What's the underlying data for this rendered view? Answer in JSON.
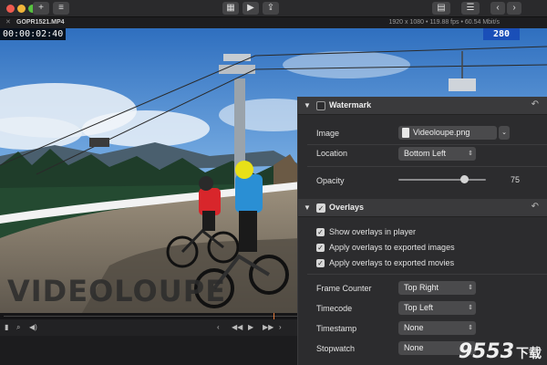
{
  "window": {
    "filename": "GOPR1521.MP4",
    "meta": "1920 x 1080 • 119.88 fps • 60.54 Mbit/s",
    "toolbar_icons": [
      "add-icon",
      "menu-icon",
      "viewer-icon",
      "play-icon",
      "export-icon",
      "grid-icon",
      "list-icon",
      "back-icon",
      "forward-icon"
    ]
  },
  "video": {
    "timecode": "00:00:02:40",
    "frame_counter": "280",
    "watermark_text": "VIDEOLOUPE",
    "playhead_progress": 0.92
  },
  "controls": {
    "left_icons": [
      "marker-icon",
      "zoom-icon",
      "volume-icon"
    ],
    "transport_icons": [
      "prev-frame-icon",
      "rewind-icon",
      "play-icon",
      "fast-forward-icon",
      "next-frame-icon"
    ]
  },
  "watermark_section": {
    "title": "Watermark",
    "enabled": false,
    "image_label": "Image",
    "image_value": "Videoloupe.png",
    "location_label": "Location",
    "location_value": "Bottom Left",
    "opacity_label": "Opacity",
    "opacity_value": "75",
    "opacity_fraction": 0.75
  },
  "overlays_section": {
    "title": "Overlays",
    "enabled": true,
    "checks": [
      {
        "label": "Show overlays in player",
        "checked": true
      },
      {
        "label": "Apply overlays to exported images",
        "checked": true
      },
      {
        "label": "Apply overlays to exported movies",
        "checked": true
      }
    ],
    "rows": [
      {
        "label": "Frame Counter",
        "value": "Top Right"
      },
      {
        "label": "Timecode",
        "value": "Top Left"
      },
      {
        "label": "Timestamp",
        "value": "None"
      },
      {
        "label": "Stopwatch",
        "value": "None"
      }
    ]
  },
  "site_watermark": {
    "text": "9553",
    "suffix": "下载"
  },
  "colors": {
    "accent_blue": "#1a4fb8",
    "playhead": "#e07a3a"
  }
}
